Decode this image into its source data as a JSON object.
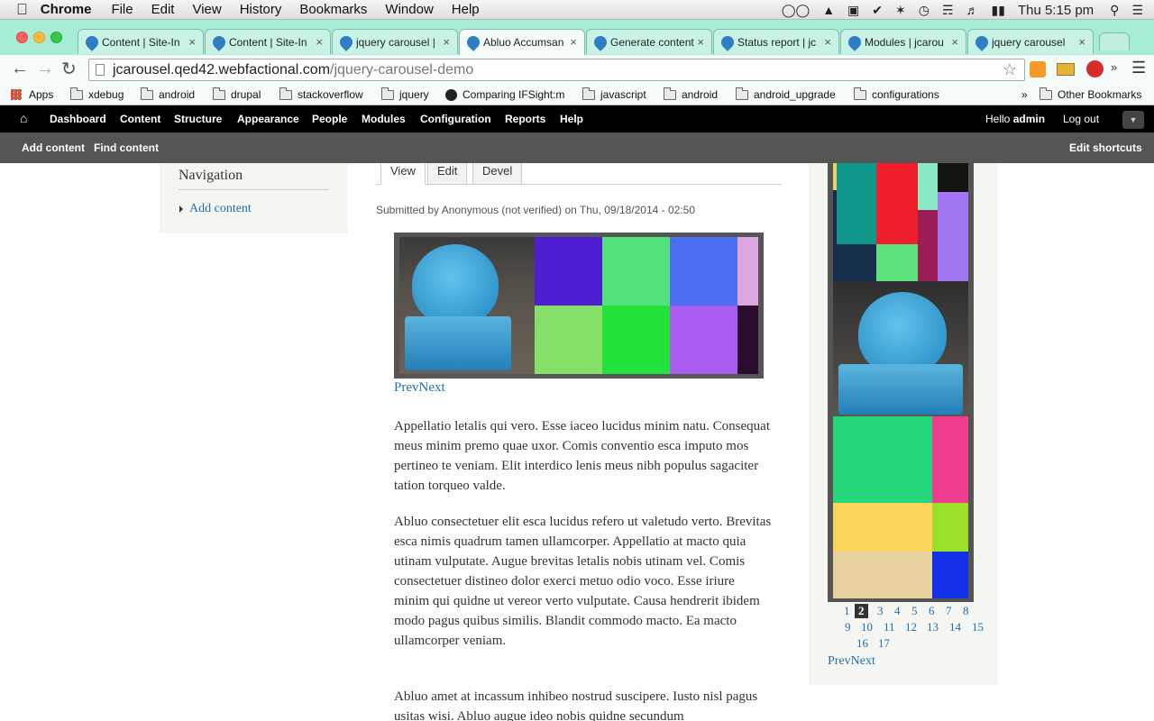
{
  "os_menubar": {
    "app": "Chrome",
    "menus": [
      "File",
      "Edit",
      "View",
      "History",
      "Bookmarks",
      "Window",
      "Help"
    ],
    "clock": "Thu 5:15 pm"
  },
  "tabs": [
    {
      "title": "Content | Site-In",
      "active": false
    },
    {
      "title": "Content | Site-In",
      "active": false
    },
    {
      "title": "jquery carousel |",
      "active": false
    },
    {
      "title": "Abluo Accumsan",
      "active": true
    },
    {
      "title": "Generate content",
      "active": false
    },
    {
      "title": "Status report | jc",
      "active": false
    },
    {
      "title": "Modules | jcarou",
      "active": false
    },
    {
      "title": "jquery carousel",
      "active": false
    }
  ],
  "address": {
    "host": "jcarousel.qed42.webfactional.com",
    "path": "/jquery-carousel-demo"
  },
  "bookmarks": [
    "Apps",
    "xdebug",
    "android",
    "drupal",
    "stackoverflow",
    "jquery",
    "Comparing IFSight:m",
    "javascript",
    "android",
    "android_upgrade",
    "configurations"
  ],
  "bookmarks_more": "»",
  "bookmarks_other": "Other Bookmarks",
  "admin_toolbar": {
    "items": [
      "Dashboard",
      "Content",
      "Structure",
      "Appearance",
      "People",
      "Modules",
      "Configuration",
      "Reports",
      "Help"
    ],
    "hello": "Hello",
    "user": "admin",
    "logout": "Log out"
  },
  "shortcuts": {
    "add": "Add content",
    "find": "Find content",
    "edit": "Edit shortcuts"
  },
  "left_sidebar": {
    "title": "Navigation",
    "link": "Add content"
  },
  "page_tabs": [
    "View",
    "Edit",
    "Devel"
  ],
  "submitted": "Submitted by Anonymous (not verified) on Thu, 09/18/2014 - 02:50",
  "carousel_nav": {
    "prev": "Prev",
    "next": "Next"
  },
  "paragraphs": [
    "Appellatio letalis qui vero. Esse iaceo lucidus minim natu. Consequat meus minim premo quae uxor. Comis conventio esca imputo mos pertineo te veniam. Elit interdico lenis meus nibh populus sagaciter tation torqueo valde.",
    "Abluo consectetuer elit esca lucidus refero ut valetudo verto. Brevitas esca nimis quadrum tamen ullamcorper. Appellatio at macto quia utinam vulputate. Augue brevitas letalis nobis utinam vel. Comis consectetuer distineo dolor exerci metuo odio voco. Esse iriure minim qui quidne ut vereor verto vulputate. Causa hendrerit ibidem modo pagus quibus similis. Blandit commodo macto. Ea macto ullamcorper veniam.",
    "Abluo amet at incassum inhibeo nostrud suscipere. Iusto nisl pagus usitas wisi. Abluo augue ideo nobis quidne secundum"
  ],
  "pager": {
    "numbers": [
      "1",
      "2",
      "3",
      "4",
      "5",
      "6",
      "7",
      "8",
      "9",
      "10",
      "11",
      "12",
      "13",
      "14",
      "15",
      "16",
      "17"
    ],
    "active": "2",
    "prev": "Prev",
    "next": "Next"
  },
  "colors": {
    "link": "#1e6fae",
    "admin_bar": "#000000",
    "shortcut_bar": "#555555",
    "chrome_frame": "#a6ecd6"
  }
}
